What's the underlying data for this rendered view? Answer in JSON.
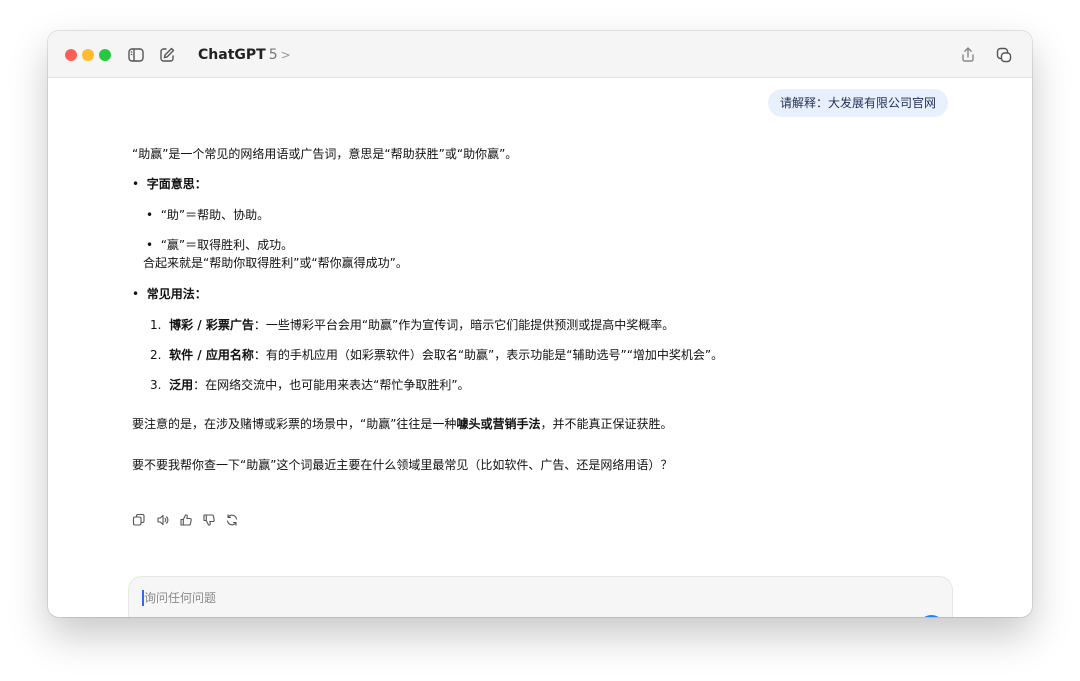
{
  "window": {
    "model_name": "ChatGPT",
    "model_version": "5",
    "model_chevron": ">"
  },
  "conversation": {
    "user_message": "请解释：大发展有限公司官网",
    "assistant": {
      "intro": "“助赢”是一个常见的网络用语或广告词，意思是“帮助获胜”或“助你赢”。",
      "literal_heading": "字面意思：",
      "literal_items": [
        "“助”＝帮助、协助。",
        "“赢”＝取得胜利、成功。"
      ],
      "literal_summary": "合起来就是“帮助你取得胜利”或“帮你赢得成功”。",
      "usage_heading": "常见用法：",
      "usage_items": [
        {
          "num": "1.",
          "title": "博彩 / 彩票广告",
          "text": "：一些博彩平台会用“助赢”作为宣传词，暗示它们能提供预测或提高中奖概率。"
        },
        {
          "num": "2.",
          "title": "软件 / 应用名称",
          "text": "：有的手机应用（如彩票软件）会取名“助赢”，表示功能是“辅助选号”“增加中奖机会”。"
        },
        {
          "num": "3.",
          "title": "泛用",
          "text": "：在网络交流中，也可能用来表达“帮忙争取胜利”。"
        }
      ],
      "warning_before": "要注意的是，在涉及赌博或彩票的场景中，“助赢”往往是一种",
      "warning_bold": "噱头或营销手法",
      "warning_after": "，并不能真正保证获胜。",
      "followup": "要不要我帮你查一下“助赢”这个词最近主要在什么领域里最常见（比如软件、广告、还是网络用语）？"
    }
  },
  "composer": {
    "placeholder": "询问任何问题",
    "tools_count_label": "5"
  },
  "bullet": "•"
}
